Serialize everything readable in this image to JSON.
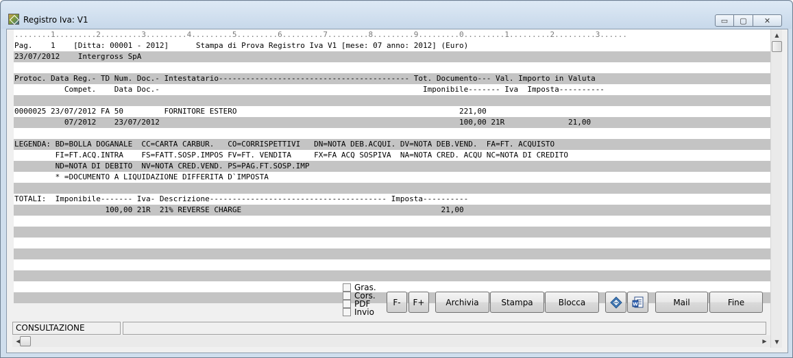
{
  "window": {
    "title": "Registro Iva: V1",
    "minimize_glyph": "▭",
    "maximize_glyph": "▢",
    "close_glyph": "✕"
  },
  "report": {
    "lines": [
      {
        "text": "........1.........2.........3.........4.........5.........6.........7.........8.........9.........0.........1.........2.........3......",
        "style": "ruler"
      },
      {
        "text": "Pag.    1    [Ditta: 00001 - 2012]      Stampa di Prova Registro Iva V1 [mese: 07 anno: 2012] (Euro)",
        "style": "white"
      },
      {
        "text": "23/07/2012    Intergross SpA",
        "style": "gray"
      },
      {
        "text": "",
        "style": "white"
      },
      {
        "text": "Protoc. Data Reg.- TD Num. Doc.- Intestatario------------------------------------------ Tot. Documento--- Val. Importo in Valuta",
        "style": "gray"
      },
      {
        "text": "           Compet.    Data Doc.-                                                          Imponibile------- Iva  Imposta----------",
        "style": "white"
      },
      {
        "text": "",
        "style": "gray"
      },
      {
        "text": "0000025 23/07/2012 FA 50         FORNITORE ESTERO                                                 221,00",
        "style": "white"
      },
      {
        "text": "           07/2012    23/07/2012                                                                  100,00 21R              21,00",
        "style": "gray"
      },
      {
        "text": "",
        "style": "white"
      },
      {
        "text": "LEGENDA: BD=BOLLA DOGANALE  CC=CARTA CARBUR.   CO=CORRISPETTIVI   DN=NOTA DEB.ACQUI. DV=NOTA DEB.VEND.  FA=FT. ACQUISTO",
        "style": "gray"
      },
      {
        "text": "         FI=FT.ACQ.INTRA    FS=FATT.SOSP.IMPOS FV=FT. VENDITA     FX=FA ACQ SOSPIVA  NA=NOTA CRED. ACQU NC=NOTA DI CREDITO",
        "style": "white"
      },
      {
        "text": "         ND=NOTA DI DEBITO  NV=NOTA CRED.VEND. PS=PAG.FT.SOSP.IMP",
        "style": "gray"
      },
      {
        "text": "         * =DOCUMENTO A LIQUIDAZIONE DIFFERITA D`IMPOSTA",
        "style": "white"
      },
      {
        "text": "",
        "style": "gray"
      },
      {
        "text": "TOTALI:  Imponibile------- Iva- Descrizione--------------------------------------- Imposta----------",
        "style": "white"
      },
      {
        "text": "                    100,00 21R  21% REVERSE CHARGE                                            21,00",
        "style": "gray"
      },
      {
        "text": "",
        "style": "white"
      },
      {
        "text": "",
        "style": "gray"
      },
      {
        "text": "",
        "style": "white"
      },
      {
        "text": "",
        "style": "gray"
      },
      {
        "text": "",
        "style": "white"
      },
      {
        "text": "",
        "style": "gray"
      },
      {
        "text": "",
        "style": "white"
      },
      {
        "text": "",
        "style": "gray"
      }
    ]
  },
  "options": {
    "gras": "Gras.",
    "cors": "Cors.",
    "pdf": "PDF",
    "invio": "Invio"
  },
  "buttons": {
    "font_minus": "F-",
    "font_plus": "F+",
    "archivia": "Archivia",
    "stampa": "Stampa",
    "blocca": "Blocca",
    "mail": "Mail",
    "fine": "Fine"
  },
  "status": {
    "mode": "CONSULTAZIONE",
    "message": ""
  },
  "icons": {
    "erase": "eraser-icon",
    "word": "word-document-icon"
  }
}
